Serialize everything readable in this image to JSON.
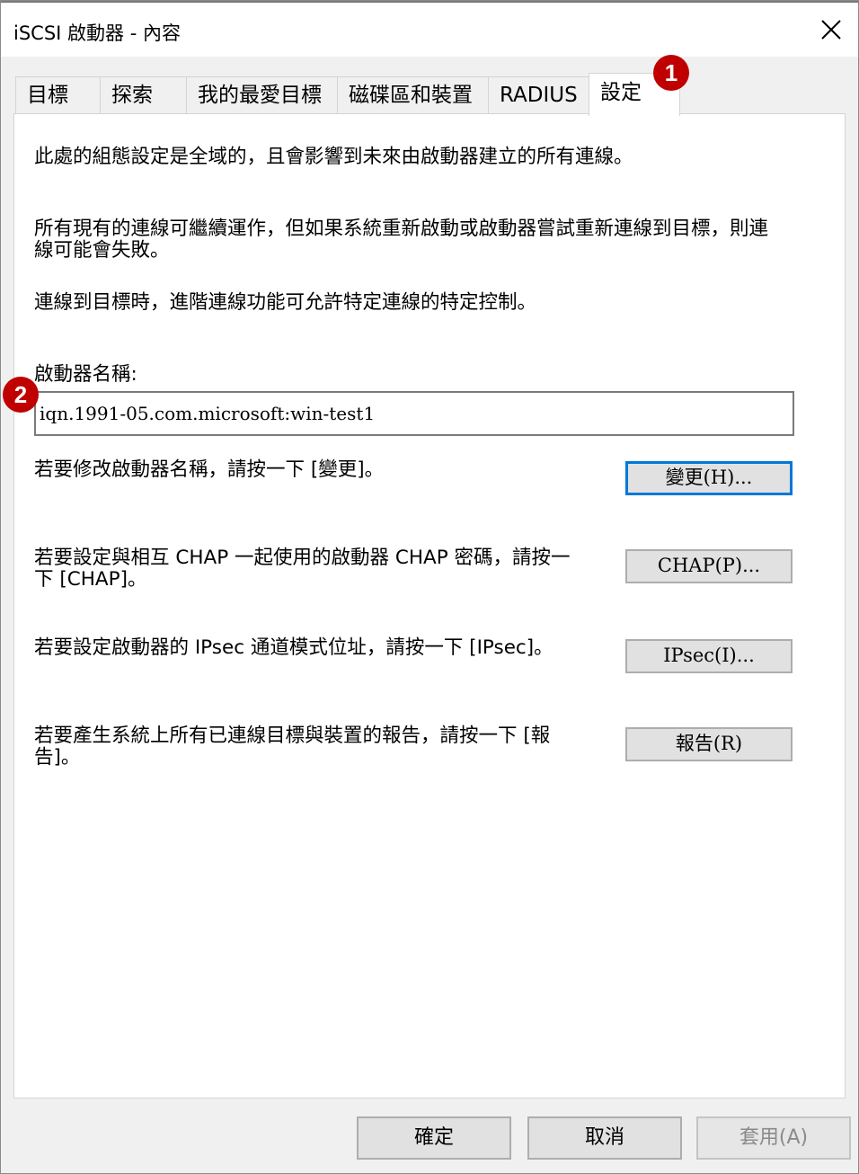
{
  "window": {
    "title": "iSCSI 啟動器 - 內容"
  },
  "tabs": [
    {
      "label": "目標"
    },
    {
      "label": "探索"
    },
    {
      "label": "我的最愛目標"
    },
    {
      "label": "磁碟區和裝置"
    },
    {
      "label": "RADIUS"
    },
    {
      "label": "設定",
      "active": true
    }
  ],
  "panel": {
    "intro1": "此處的組態設定是全域的，且會影響到未來由啟動器建立的所有連線。",
    "intro2": "所有現有的連線可繼續運作，但如果系統重新啟動或啟動器嘗試重新連線到目標，則連線可能會失敗。",
    "intro3": "連線到目標時，進階連線功能可允許特定連線的特定控制。",
    "initiator_label": "啟動器名稱:",
    "initiator_value": "iqn.1991-05.com.microsoft:win-test1",
    "change_desc": "若要修改啟動器名稱，請按一下 [變更]。",
    "change_button": "變更(H)...",
    "chap_desc": "若要設定與相互 CHAP 一起使用的啟動器 CHAP 密碼，請按一下 [CHAP]。",
    "chap_button": "CHAP(P)...",
    "ipsec_desc": "若要設定啟動器的 IPsec 通道模式位址，請按一下 [IPsec]。",
    "ipsec_button": "IPsec(I)...",
    "report_desc": "若要產生系統上所有已連線目標與裝置的報告，請按一下 [報告]。",
    "report_button": "報告(R)"
  },
  "footer": {
    "ok": "確定",
    "cancel": "取消",
    "apply": "套用(A)"
  },
  "markers": {
    "m1": "1",
    "m2": "2"
  },
  "colors": {
    "accent": "#0078d7",
    "marker": "#c00000"
  }
}
